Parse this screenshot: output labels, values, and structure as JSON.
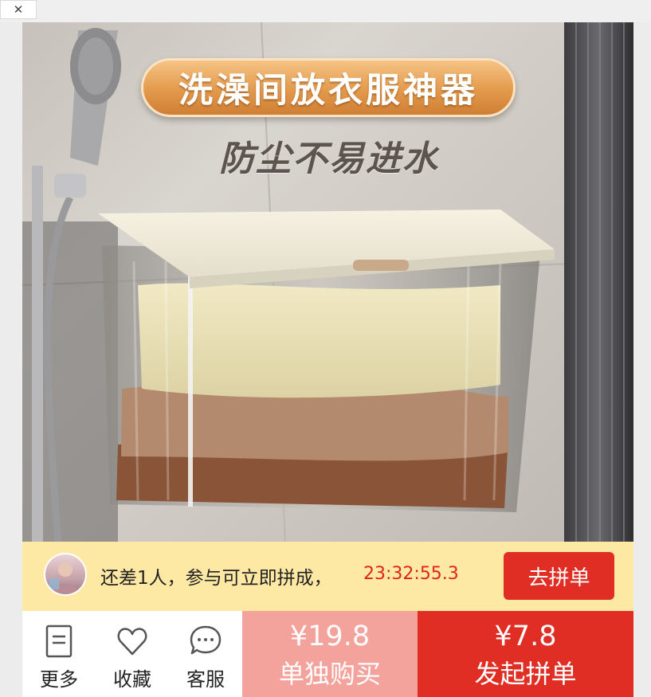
{
  "window": {
    "close_glyph": "✕"
  },
  "hero": {
    "title": "洗澡间放衣服神器",
    "subtitle": "防尘不易进水"
  },
  "group": {
    "message": "还差1人，参与可立即拼成，",
    "countdown": "23:32:55.3",
    "join_label": "去拼单"
  },
  "nav": {
    "more": {
      "label": "更多",
      "icon": "document-list-icon"
    },
    "favorite": {
      "label": "收藏",
      "icon": "heart-icon"
    },
    "service": {
      "label": "客服",
      "icon": "chat-bubble-icon"
    }
  },
  "buy_solo": {
    "price": "¥19.8",
    "label": "单独购买"
  },
  "buy_group": {
    "price": "¥7.8",
    "label": "发起拼单"
  },
  "colors": {
    "brand_red": "#e02e24",
    "solo_pink": "#f3a29c",
    "banner_yellow": "#fde8a4",
    "countdown_red": "#e2231a"
  }
}
